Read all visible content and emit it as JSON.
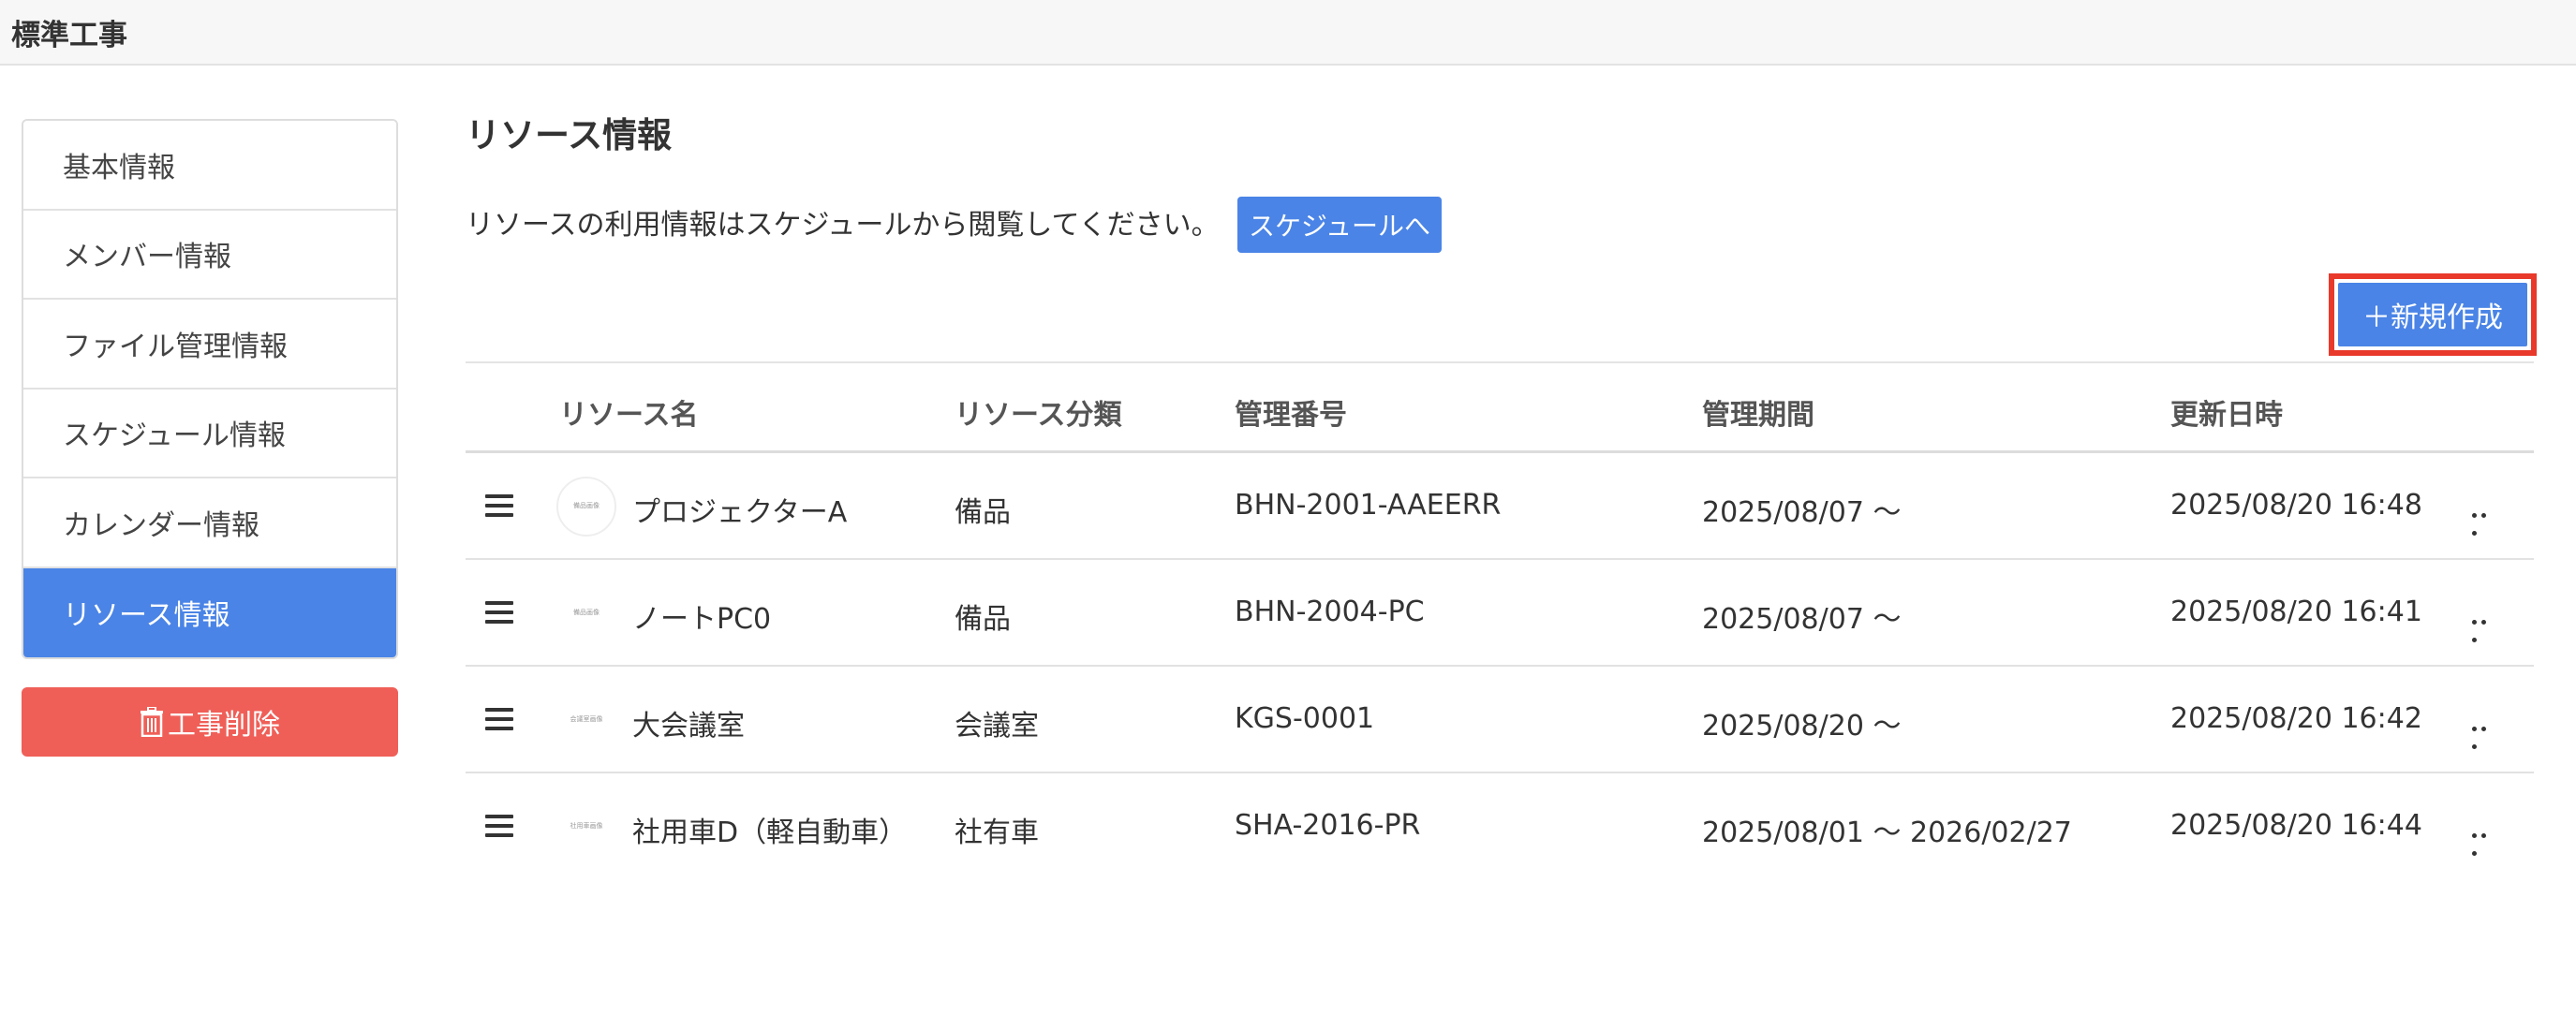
{
  "app": {
    "title": "標準工事"
  },
  "sidebar": {
    "items": [
      {
        "label": "基本情報",
        "active": false
      },
      {
        "label": "メンバー情報",
        "active": false
      },
      {
        "label": "ファイル管理情報",
        "active": false
      },
      {
        "label": "スケジュール情報",
        "active": false
      },
      {
        "label": "カレンダー情報",
        "active": false
      },
      {
        "label": "リソース情報",
        "active": true
      }
    ],
    "delete_label": "工事削除"
  },
  "main": {
    "title": "リソース情報",
    "notice": "リソースの利用情報はスケジュールから閲覧してください。",
    "schedule_button": "スケジュールへ",
    "new_button": "＋新規作成"
  },
  "table": {
    "headers": {
      "name": "リソース名",
      "category": "リソース分類",
      "number": "管理番号",
      "period": "管理期間",
      "updated": "更新日時"
    },
    "rows": [
      {
        "thumb": "備品画像",
        "name": "プロジェクターA",
        "category": "備品",
        "number": "BHN-2001-AAEERR",
        "period": "2025/08/07 〜",
        "updated": "2025/08/20 16:48"
      },
      {
        "thumb": "備品画像",
        "name": "ノートPC0",
        "category": "備品",
        "number": "BHN-2004-PC",
        "period": "2025/08/07 〜",
        "updated": "2025/08/20 16:41"
      },
      {
        "thumb": "会議室画像",
        "name": "大会議室",
        "category": "会議室",
        "number": "KGS-0001",
        "period": "2025/08/20 〜",
        "updated": "2025/08/20 16:42"
      },
      {
        "thumb": "社用車画像",
        "name": "社用車D（軽自動車）",
        "category": "社有車",
        "number": "SHA-2016-PR",
        "period": "2025/08/01 〜 2026/02/27",
        "updated": "2025/08/20 16:44"
      }
    ]
  },
  "colors": {
    "accent": "#4a84e6",
    "danger": "#ef5f58",
    "highlight": "#e8392b"
  }
}
